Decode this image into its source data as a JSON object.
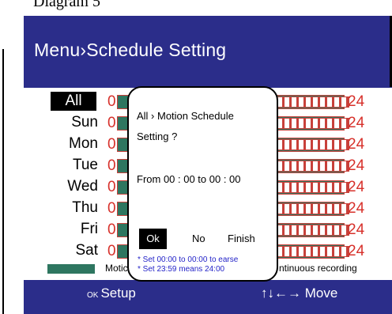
{
  "caption": "Diagram 5",
  "header": {
    "title": "Menu›Schedule Setting"
  },
  "days": [
    "All",
    "Sun",
    "Mon",
    "Tue",
    "Wed",
    "Thu",
    "Fri",
    "Sat"
  ],
  "scale": {
    "start": "0",
    "end": "24"
  },
  "legend": {
    "motion_label": "Motic",
    "continuous_label": "ntinuous recording"
  },
  "dialog": {
    "line1": "All › Motion Schedule",
    "line2": "Setting ?",
    "range": "From  00 : 00 to 00 : 00",
    "ok": "Ok",
    "no": "No",
    "finish": "Finish",
    "note1": "* Set 00:00 to 00:00 to earse",
    "note2": "* Set 23:59 means 24:00"
  },
  "footer": {
    "ok_prefix": "OK",
    "setup": "Setup",
    "move": "↑↓←→ Move"
  },
  "colors": {
    "header_bg": "#2b2d8a",
    "bar": "#2e7660",
    "accent_red": "#d7302a",
    "note_blue": "#2424c8"
  }
}
